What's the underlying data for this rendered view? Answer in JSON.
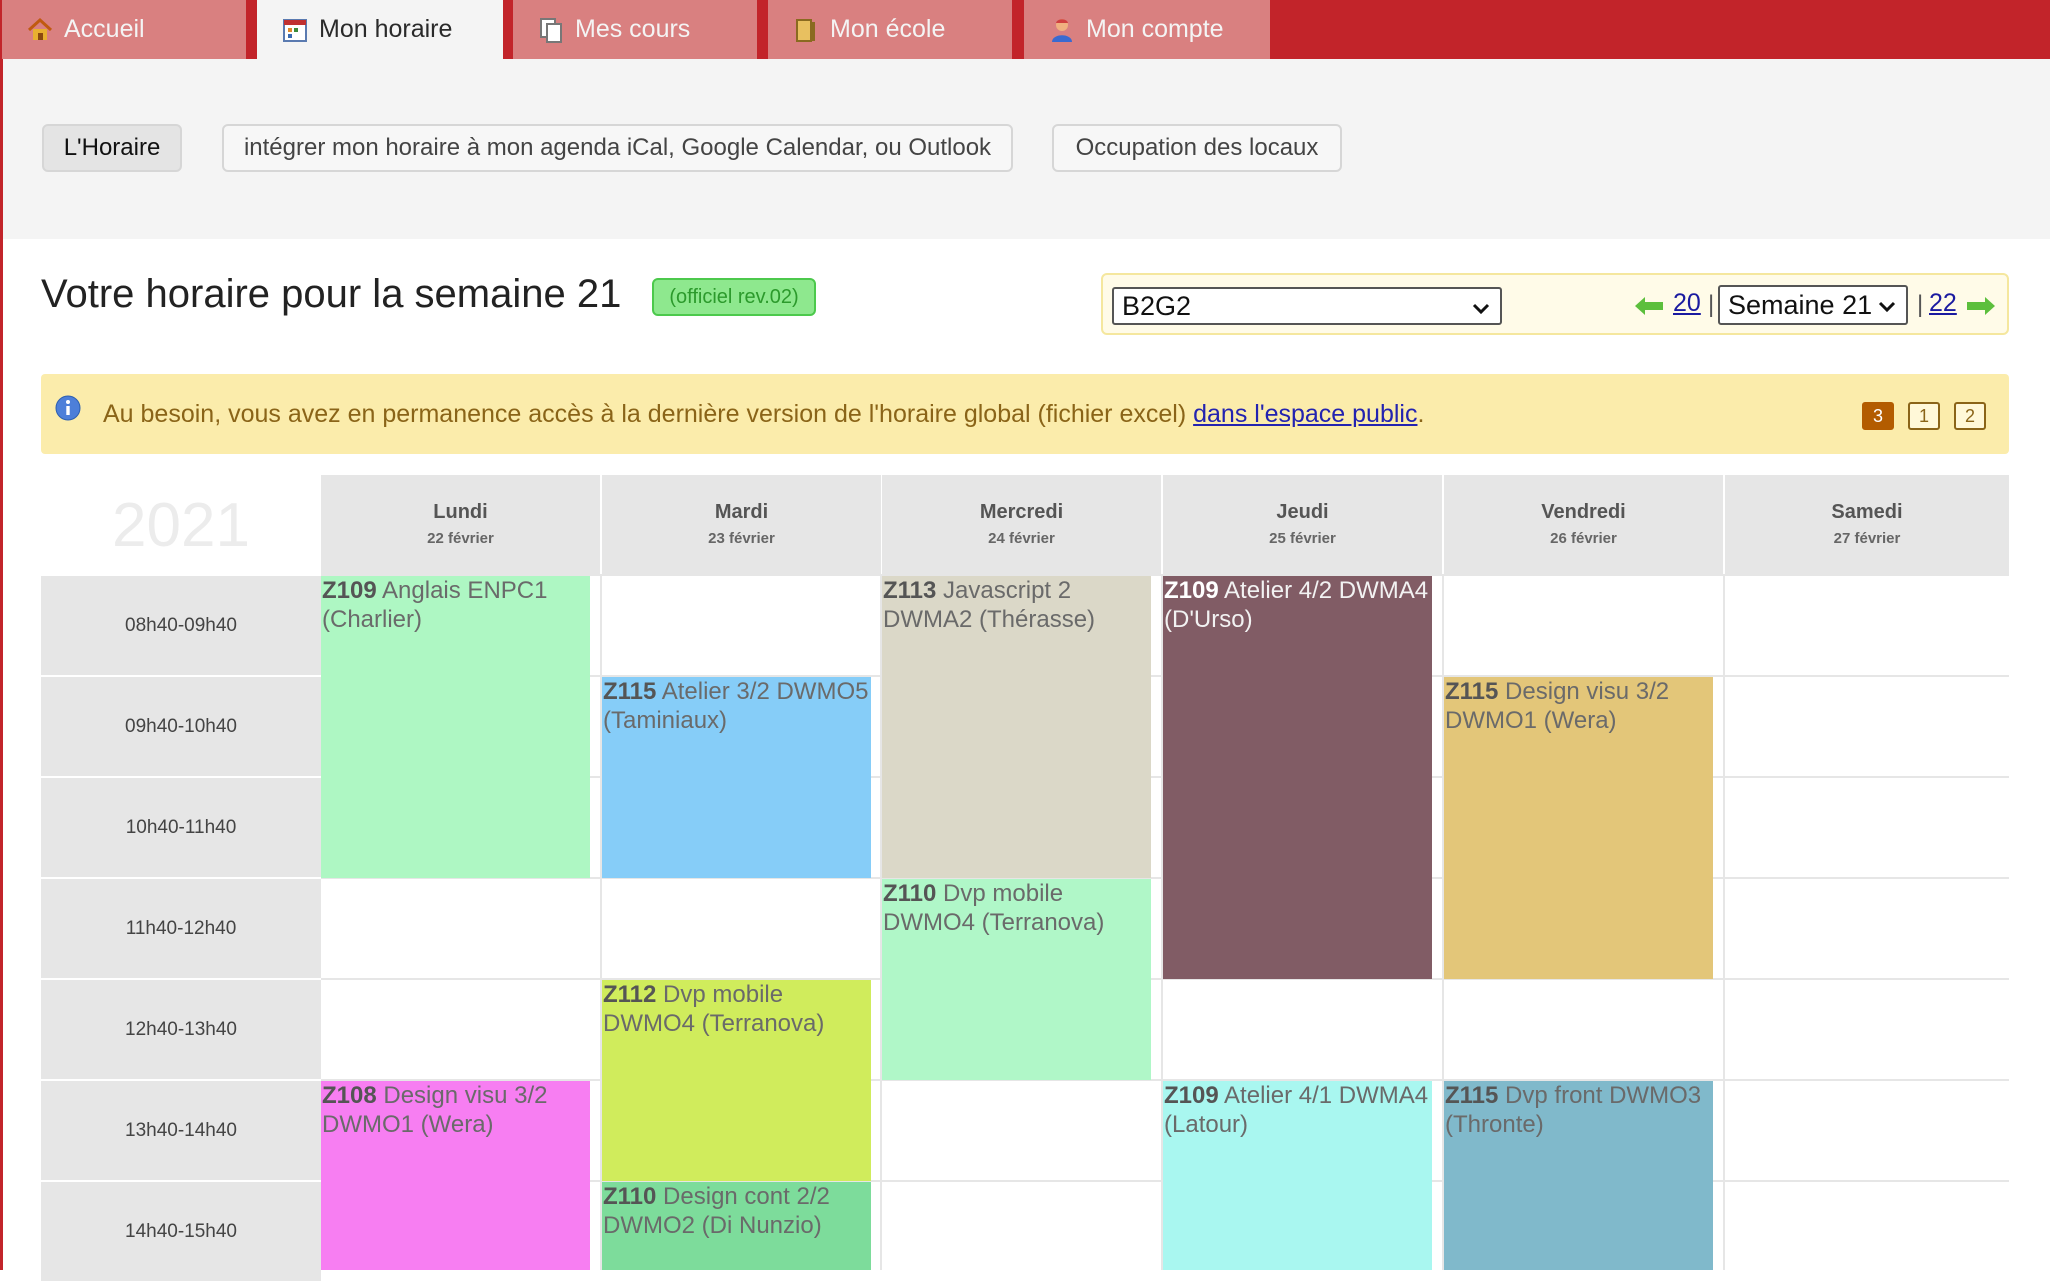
{
  "nav": {
    "tabs": [
      {
        "label": "Accueil",
        "icon": "home-icon",
        "active": false
      },
      {
        "label": "Mon horaire",
        "icon": "calendar-icon",
        "active": true
      },
      {
        "label": "Mes cours",
        "icon": "documents-icon",
        "active": false
      },
      {
        "label": "Mon école",
        "icon": "school-icon",
        "active": false
      },
      {
        "label": "Mon compte",
        "icon": "user-icon",
        "active": false
      }
    ]
  },
  "toolbar": {
    "horaire_label": "L'Horaire",
    "ical_label": "intégrer mon horaire à mon agenda iCal, Google Calendar, ou Outlook",
    "locaux_label": "Occupation des locaux"
  },
  "header": {
    "title": "Votre horaire pour la semaine 21",
    "badge": "(officiel rev.02)"
  },
  "selector": {
    "group_value": "B2G2",
    "prev_week": "20",
    "week_value": "Semaine 21",
    "next_week": "22",
    "separator": "|"
  },
  "info": {
    "text": "Au besoin, vous avez en permanence accès à la dernière version de l'horaire global (fichier excel)",
    "link": "dans l'espace public",
    "trailing": ".",
    "pages": [
      "3",
      "1",
      "2"
    ],
    "current_page": "3"
  },
  "timetable": {
    "year": "2021",
    "days": [
      {
        "name": "Lundi",
        "date": "22 février"
      },
      {
        "name": "Mardi",
        "date": "23 février"
      },
      {
        "name": "Mercredi",
        "date": "24 février"
      },
      {
        "name": "Jeudi",
        "date": "25 février"
      },
      {
        "name": "Vendredi",
        "date": "26 février"
      },
      {
        "name": "Samedi",
        "date": "27 février"
      }
    ],
    "slots": [
      "08h40-09h40",
      "09h40-10h40",
      "10h40-11h40",
      "11h40-12h40",
      "12h40-13h40",
      "13h40-14h40",
      "14h40-15h40"
    ],
    "courses": [
      {
        "day": 0,
        "start": 0,
        "span": 3,
        "room": "Z109",
        "text": " Anglais ENPC1 (Charlier)",
        "color": "#aef7c3"
      },
      {
        "day": 0,
        "start": 5,
        "span": 2,
        "room": "Z108",
        "text": " Design visu 3/2 DWMO1 (Wera)",
        "color": "#f77ef2"
      },
      {
        "day": 1,
        "start": 1,
        "span": 2,
        "room": "Z115",
        "text": " Atelier 3/2 DWMO5 (Taminiaux)",
        "color": "#86cdf8"
      },
      {
        "day": 1,
        "start": 4,
        "span": 2,
        "room": "Z112",
        "text": " Dvp mobile DWMO4 (Terranova)",
        "color": "#d0ec5c"
      },
      {
        "day": 1,
        "start": 6,
        "span": 1,
        "room": "Z110",
        "text": " Design cont 2/2 DWMO2 (Di Nunzio)",
        "color": "#7ddc9b"
      },
      {
        "day": 2,
        "start": 0,
        "span": 3,
        "room": "Z113",
        "text": " Javascript 2 DWMA2 (Thérasse)",
        "color": "#dbd8c8"
      },
      {
        "day": 2,
        "start": 3,
        "span": 2,
        "room": "Z110",
        "text": " Dvp mobile DWMO4 (Terranova)",
        "color": "#b0f7c8"
      },
      {
        "day": 3,
        "start": 0,
        "span": 4,
        "room": "Z109",
        "text": " Atelier 4/2 DWMA4 (D'Urso)",
        "color": "#815c65",
        "dark": true
      },
      {
        "day": 3,
        "start": 5,
        "span": 2,
        "room": "Z109",
        "text": " Atelier 4/1 DWMA4 (Latour)",
        "color": "#a9f7f0"
      },
      {
        "day": 4,
        "start": 1,
        "span": 3,
        "room": "Z115",
        "text": " Design visu 3/2 DWMO1 (Wera)",
        "color": "#e3c679"
      },
      {
        "day": 4,
        "start": 5,
        "span": 2,
        "room": "Z115",
        "text": " Dvp front DWMO3 (Thronte)",
        "color": "#80b9cb"
      }
    ]
  }
}
